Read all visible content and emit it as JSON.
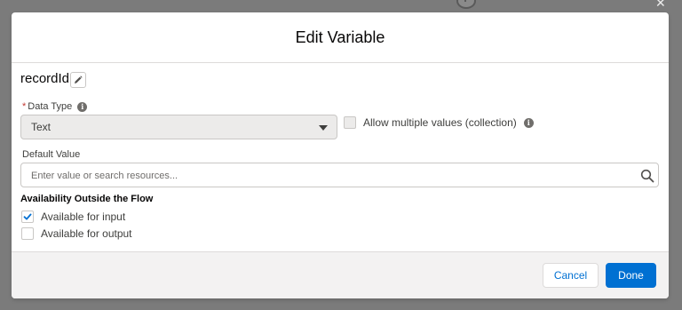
{
  "modal": {
    "title": "Edit Variable"
  },
  "variable": {
    "name": "recordId"
  },
  "data_type": {
    "required_marker": "*",
    "label": "Data Type",
    "selected_value": "Text"
  },
  "collection": {
    "label": "Allow multiple values (collection)",
    "checked": false,
    "disabled": true
  },
  "default_value": {
    "label": "Default Value",
    "value": "",
    "placeholder": "Enter value or search resources..."
  },
  "availability": {
    "title": "Availability Outside the Flow",
    "input_label": "Available for input",
    "input_checked": true,
    "output_label": "Available for output",
    "output_checked": false
  },
  "footer": {
    "cancel_label": "Cancel",
    "done_label": "Done"
  },
  "colors": {
    "brand": "#0070d2",
    "required": "#c23934",
    "overlay": "#7b7b7b"
  },
  "icons": {
    "edit": "pencil-icon",
    "info": "info-icon",
    "search": "search-icon",
    "caret": "chevron-down-icon",
    "check": "check-icon"
  }
}
